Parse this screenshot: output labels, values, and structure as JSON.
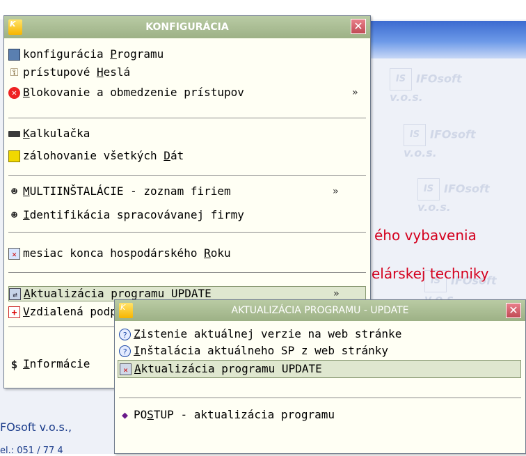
{
  "background": {
    "logo_text": "IFOsoft v.o.s.",
    "line1": "ého vybavenia",
    "line2": "elárskej techniky",
    "company": "FOsoft v.o.s.,",
    "phone": "el.: 051 / 77 4"
  },
  "main_menu": {
    "logo": "K",
    "title": "KONFIGURÁCIA",
    "close": "✕",
    "items": [
      {
        "pre": "konfigurácia ",
        "u": "P",
        "post": "rogramu",
        "icon": "config-icon",
        "arrow": ""
      },
      {
        "pre": "prístupové ",
        "u": "H",
        "post": "eslá",
        "icon": "key-icon",
        "arrow": ""
      },
      {
        "pre": "",
        "u": "B",
        "post": "lokovanie a obmedzenie prístupov",
        "icon": "block-icon",
        "arrow": "»"
      },
      {
        "pre": "",
        "u": "K",
        "post": "alkulačka",
        "icon": "calculator-icon",
        "arrow": ""
      },
      {
        "pre": "zálohovanie všetkých ",
        "u": "D",
        "post": "át",
        "icon": "backup-icon",
        "arrow": ""
      },
      {
        "pre": "",
        "u": "M",
        "post": "ULTIINŠTALÁCIE - zoznam firiem",
        "icon": "multi-install-icon",
        "arrow": "»"
      },
      {
        "pre": "",
        "u": "I",
        "post": "dentifikácia spracovávanej firmy",
        "icon": "identity-icon",
        "arrow": ""
      },
      {
        "pre": "mesiac konca hospodárského ",
        "u": "R",
        "post": "oku",
        "icon": "month-icon",
        "arrow": ""
      },
      {
        "pre": "",
        "u": "A",
        "post": "ktualizácia programu UPDATE",
        "icon": "update-icon",
        "arrow": "»"
      },
      {
        "pre": "",
        "u": "V",
        "post": "zdialená podpora",
        "icon": "remote-support-icon",
        "arrow": ""
      },
      {
        "pre": "",
        "u": "I",
        "post": "nformácie",
        "icon": "info-icon",
        "arrow": ""
      }
    ]
  },
  "sub_menu": {
    "logo": "K",
    "title": "AKTUALIZÁCIA PROGRAMU - UPDATE",
    "close": "✕",
    "items": [
      {
        "pre": "",
        "u": "Z",
        "post": "istenie aktuálnej verzie na web stránke",
        "icon": "question-icon"
      },
      {
        "pre": "",
        "u": "I",
        "post": "nštalácia aktuálneho SP z web stránky",
        "icon": "question-icon"
      },
      {
        "pre": "",
        "u": "A",
        "post": "ktualizácia programu  UPDATE",
        "icon": "update-program-icon"
      },
      {
        "pre": "PO",
        "u": "S",
        "post": "TUP - aktualizácia programu",
        "icon": "procedure-icon"
      }
    ]
  }
}
